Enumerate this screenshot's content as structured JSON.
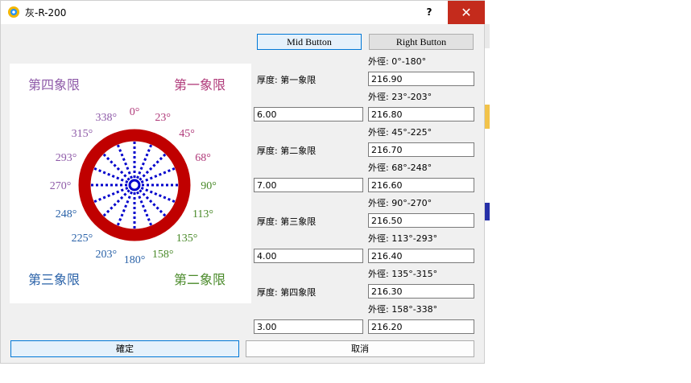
{
  "window": {
    "title": "灰-R-200",
    "help_label": "?",
    "close_label": "✕"
  },
  "colors": {
    "ring": "#c00000",
    "spokes": "#0000cc",
    "q1": "#b03a7a",
    "q2": "#4a8a2a",
    "q3": "#2a62a8",
    "q4": "#8e5aa8"
  },
  "diagram": {
    "quadrants": {
      "q4": "第四象限",
      "q1": "第一象限",
      "q3": "第三象限",
      "q2": "第二象限"
    },
    "angles": [
      "0°",
      "23°",
      "45°",
      "68°",
      "90°",
      "113°",
      "135°",
      "158°",
      "180°",
      "203°",
      "225°",
      "248°",
      "270°",
      "293°",
      "315°",
      "338°"
    ]
  },
  "buttons": {
    "mid": "Mid Button",
    "right": "Right Button",
    "ok": "確定",
    "cancel": "取消"
  },
  "thickness": [
    {
      "label": "厚度: 第一象限",
      "value": "6.00"
    },
    {
      "label": "厚度: 第二象限",
      "value": "7.00"
    },
    {
      "label": "厚度: 第三象限",
      "value": "4.00"
    },
    {
      "label": "厚度: 第四象限",
      "value": "3.00"
    }
  ],
  "outer": [
    {
      "label": "外徑: 0°-180°",
      "value": "216.90"
    },
    {
      "label": "外徑: 23°-203°",
      "value": "216.80"
    },
    {
      "label": "外徑: 45°-225°",
      "value": "216.70"
    },
    {
      "label": "外徑: 68°-248°",
      "value": "216.60"
    },
    {
      "label": "外徑: 90°-270°",
      "value": "216.50"
    },
    {
      "label": "外徑: 113°-293°",
      "value": "216.40"
    },
    {
      "label": "外徑: 135°-315°",
      "value": "216.30"
    },
    {
      "label": "外徑: 158°-338°",
      "value": "216.20"
    }
  ]
}
